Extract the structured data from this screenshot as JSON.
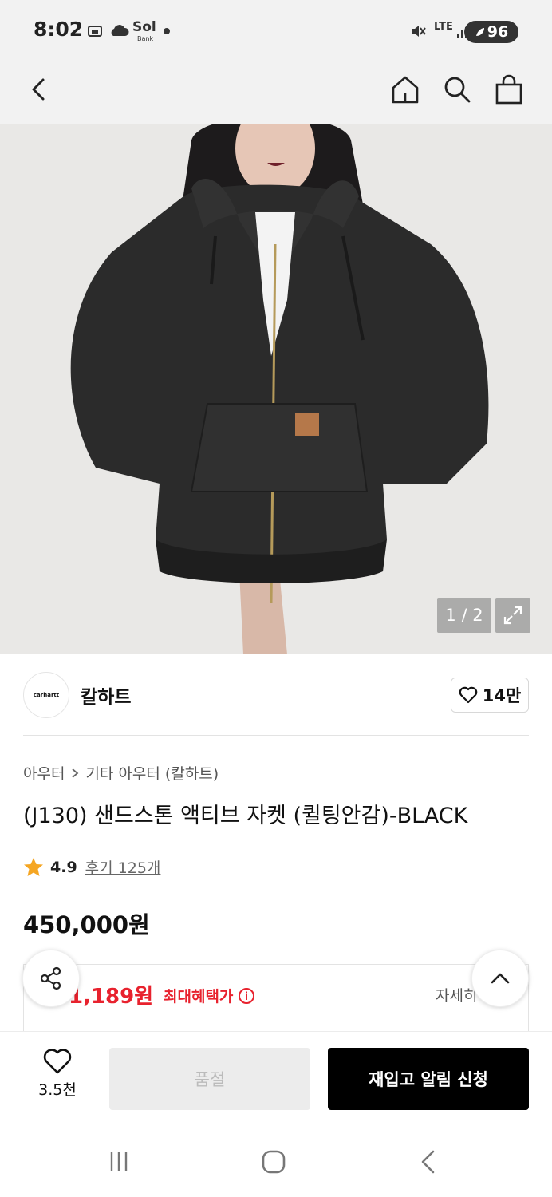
{
  "status": {
    "time": "8:02",
    "carrier_badge": "Sol",
    "carrier_sub": "Bank",
    "network": "LTE",
    "battery": "96"
  },
  "header": {
    "icons": [
      "back-icon",
      "home-icon",
      "search-icon",
      "cart-icon"
    ]
  },
  "hero": {
    "pager": "1 / 2"
  },
  "brand": {
    "logo_text": "carhartt",
    "name": "칼하트",
    "likes": "14만"
  },
  "product": {
    "breadcrumb": [
      "아우터",
      "기타 아우터 (칼하트)"
    ],
    "title": "(J130) 샌드스톤 액티브 자켓 (퀼팅안감)-BLACK",
    "rating": "4.9",
    "reviews": "후기 125개",
    "price": "450,000원"
  },
  "benefit": {
    "price": "1,189원",
    "label": "최대혜택가",
    "detail": "자세히"
  },
  "bottom": {
    "wish_count": "3.5천",
    "soldout_label": "품절",
    "restock_label": "재입고 알림 신청"
  },
  "colors": {
    "accent_red": "#e8222e",
    "star": "#f5a623",
    "primary_button": "#000000"
  }
}
